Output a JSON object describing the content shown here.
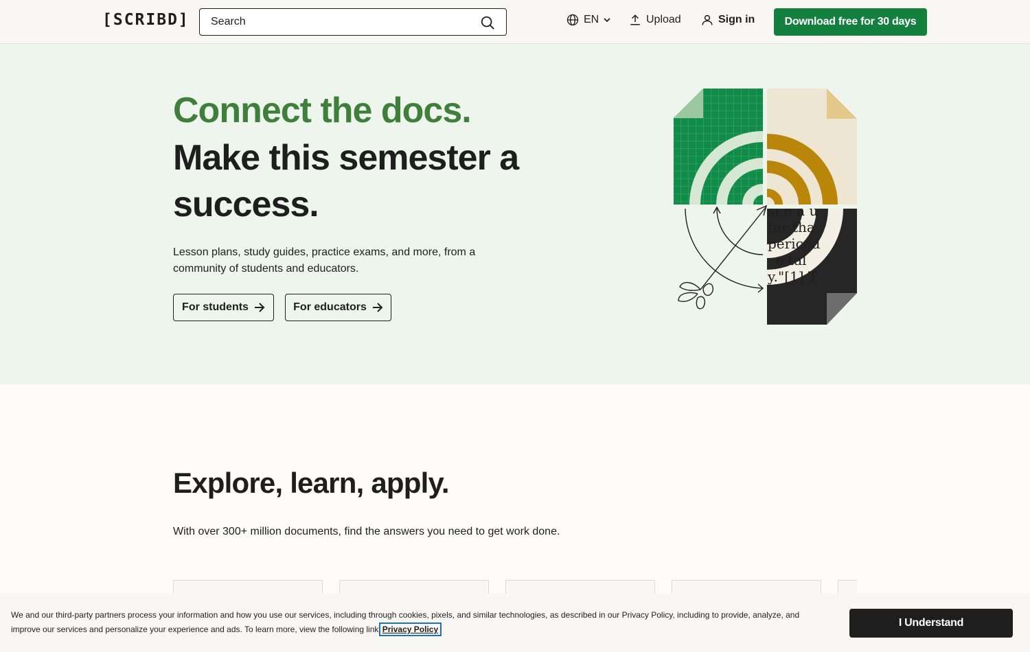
{
  "header": {
    "logo": "[SCRIBD]",
    "search_placeholder": "Search",
    "language": "EN",
    "upload_label": "Upload",
    "signin_label": "Sign in",
    "cta_label": "Download free for 30 days"
  },
  "hero": {
    "title_green": "Connect the docs.",
    "title_dark": "Make this semester a success.",
    "subtitle": "Lesson plans, study guides, practice exams, and more, from a community of students and educators.",
    "buttons": [
      {
        "label": "For students"
      },
      {
        "label": "For educators"
      }
    ]
  },
  "explore": {
    "title": "Explore, learn, apply.",
    "subtitle": "With over 300+ million documents, find the answers you need to get work done."
  },
  "illustration": {
    "text_lines": [
      "si n a u",
      "tor tha",
      "periced",
      "e tal",
      "y.\"[1] T"
    ]
  },
  "cookie": {
    "text": "We and our third-party partners process your information and how you use our services, including through cookies, pixels, and similar technologies, as described in our Privacy Policy, including to provide, analyze, and improve our services and personalize your experience and ads. To learn more, view the following link",
    "link": "Privacy Policy",
    "accept_label": "I Understand"
  },
  "colors": {
    "brand_green": "#148040",
    "headline_green": "#3f7f3b",
    "hero_bg": "#eef5ec",
    "ochre": "#b9860a",
    "dark": "#1e1e1e"
  }
}
